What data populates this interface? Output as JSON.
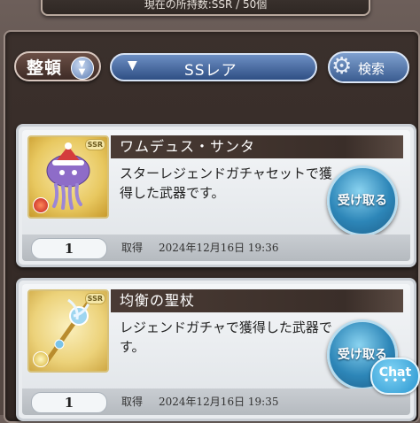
{
  "top_banner": {
    "text": "現在の所持数:SSR / 50個"
  },
  "toolbar": {
    "sort_label": "整頓",
    "rarity_label": "SSレア",
    "search_label": "検索"
  },
  "items": [
    {
      "name": "ワムデュス・サンタ",
      "description": "スターレジェンドガチャセットで獲得した武器です。",
      "receive_label": "受け取る",
      "quantity": "1",
      "acquired_label": "取得",
      "acquired_date": "2024年12月16日 19:36",
      "rarity": "SSR"
    },
    {
      "name": "均衡の聖杖",
      "description": "レジェンドガチャで獲得した武器です。",
      "receive_label": "受け取る",
      "quantity": "1",
      "acquired_label": "取得",
      "acquired_date": "2024年12月16日 19:35",
      "rarity": "SSR"
    }
  ],
  "chat": {
    "label": "Chat"
  }
}
